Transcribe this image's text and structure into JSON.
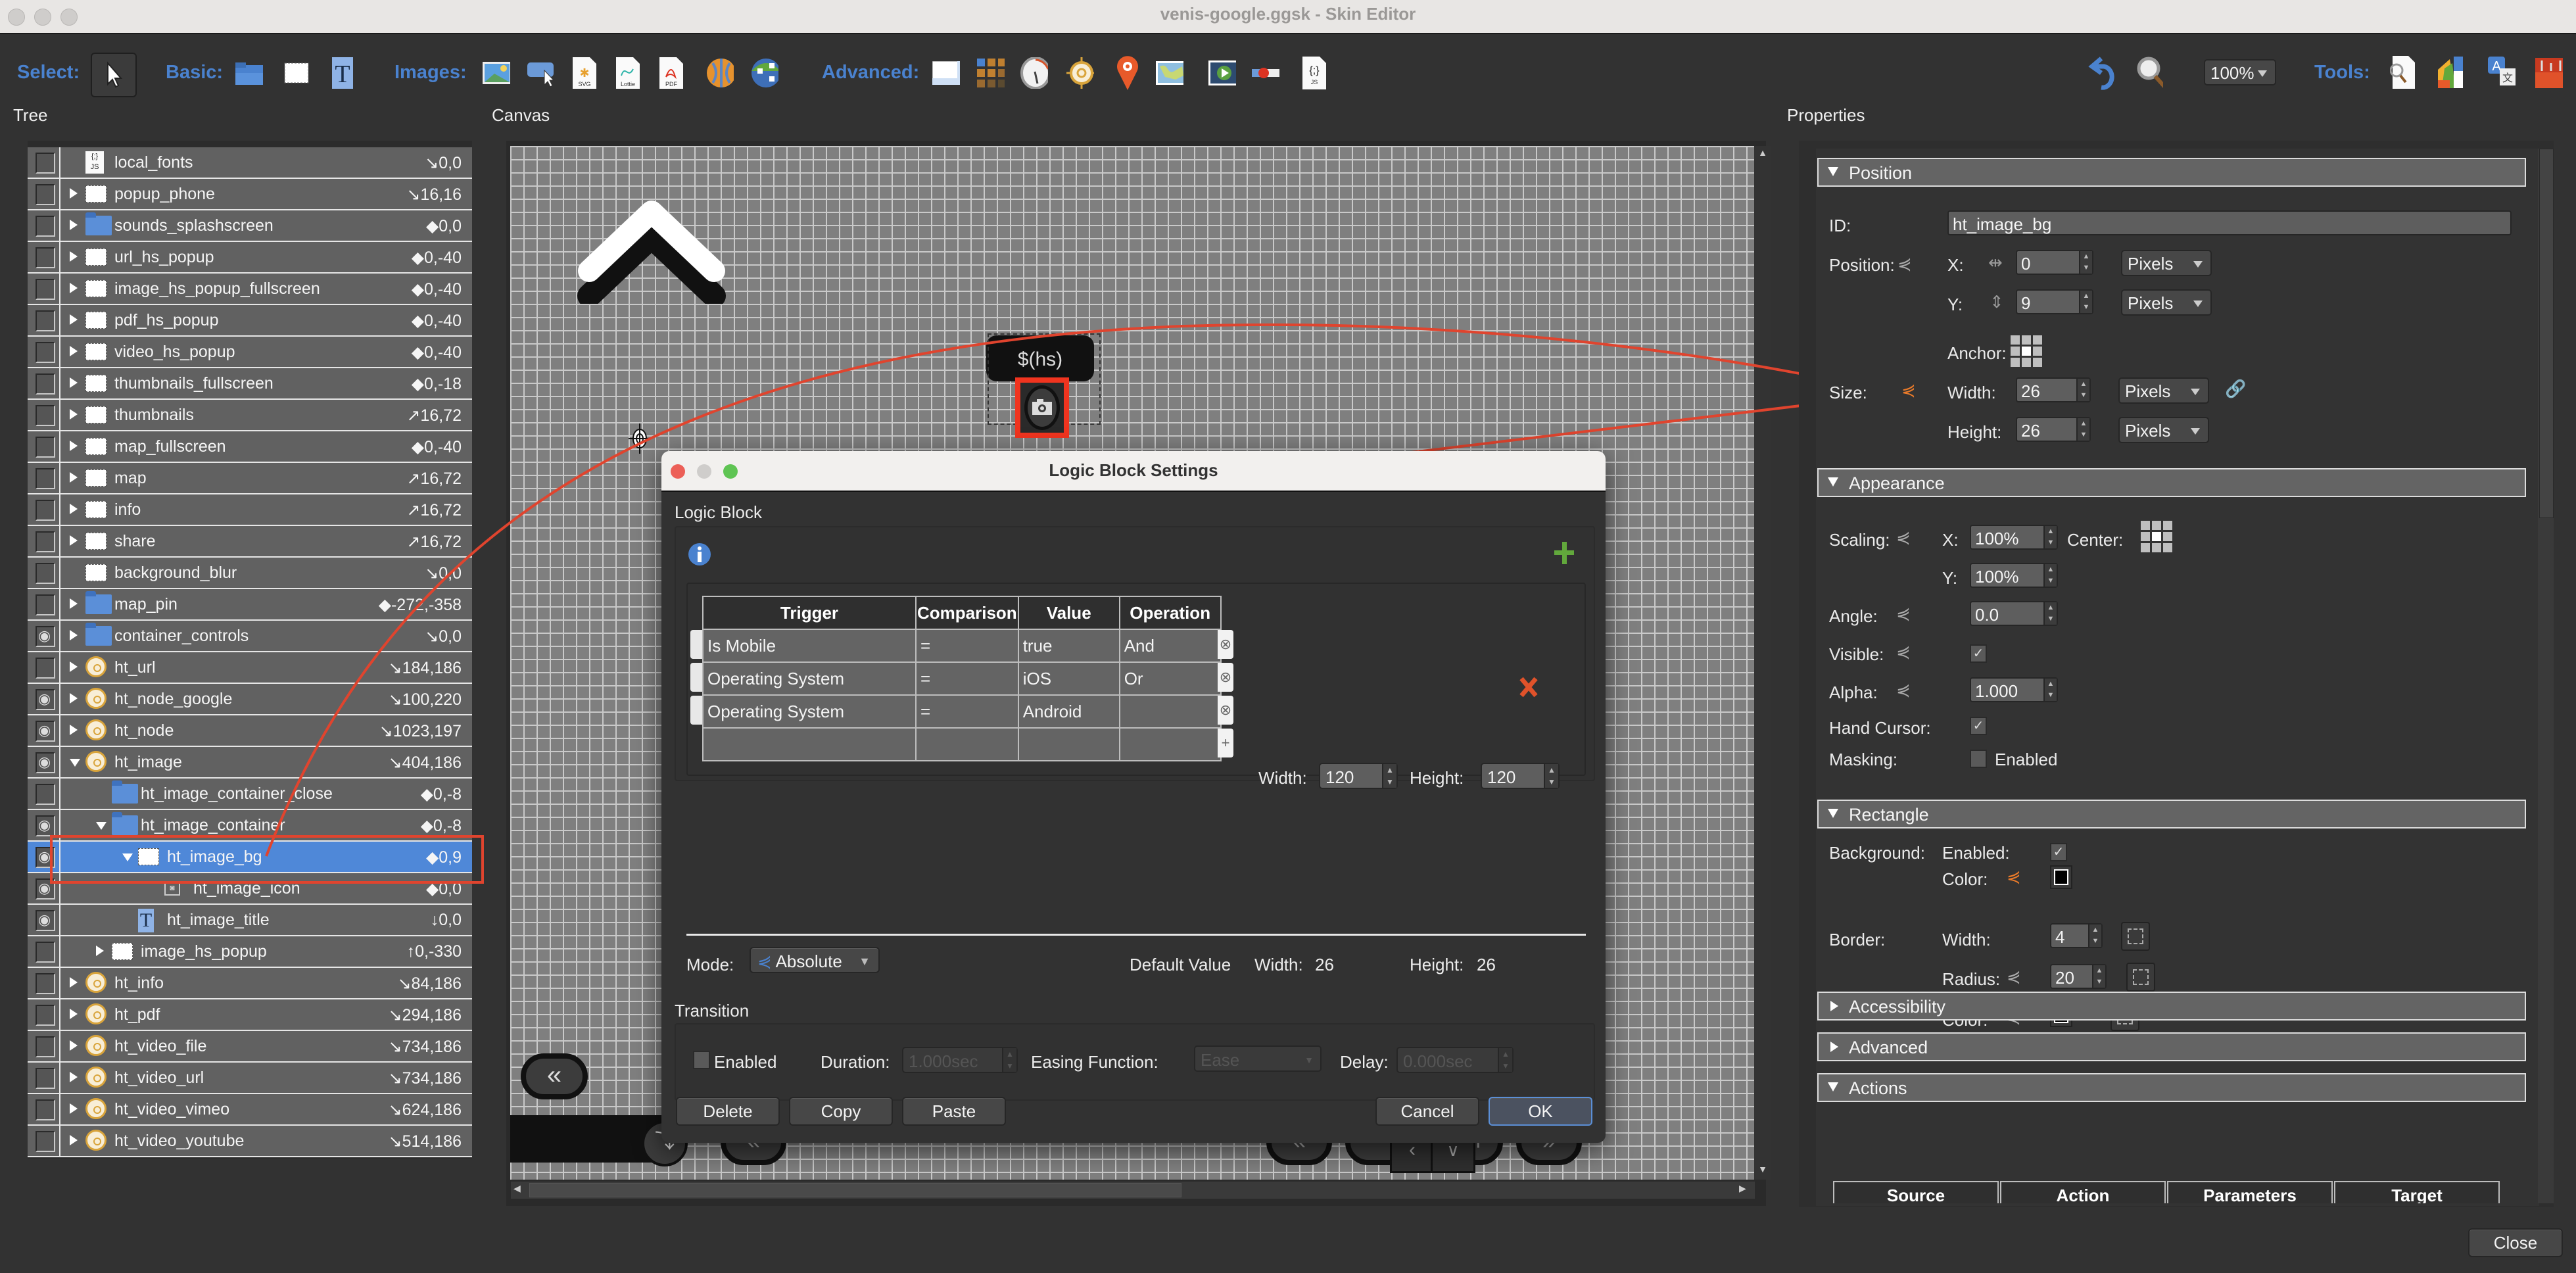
{
  "window": {
    "title": "venis-google.ggsk - Skin Editor"
  },
  "toolbar": {
    "select_label": "Select:",
    "basic_label": "Basic:",
    "images_label": "Images:",
    "advanced_label": "Advanced:",
    "tools_label": "Tools:",
    "zoom_value": "100%",
    "select_tools": [
      "pointer-icon"
    ],
    "basic_tools": [
      "container-folder-icon",
      "rectangle-icon",
      "text-icon"
    ],
    "image_tools": [
      "image-icon",
      "button-icon",
      "svg-icon",
      "lottie-icon",
      "pdf-icon",
      "panorama-icon",
      "node-icon"
    ],
    "advanced_tools": [
      "scrollarea-icon",
      "cloner-icon",
      "timer-icon",
      "hotspot-icon",
      "map-pin-icon",
      "map-icon",
      "video-icon",
      "slider-icon",
      "code-icon"
    ],
    "right_tools": [
      "undo-icon",
      "zoom-tool-icon"
    ],
    "tool_icons": [
      "file-search-icon",
      "color-palette-icon",
      "translate-icon",
      "toolbox-icon"
    ]
  },
  "panels": {
    "tree_title": "Tree",
    "canvas_title": "Canvas",
    "properties_title": "Properties"
  },
  "tree": {
    "rows": [
      {
        "name": "local_fonts",
        "coord": "↘0,0",
        "icon": "code",
        "indent": 0,
        "expander": "none",
        "visible": false,
        "selected": false
      },
      {
        "name": "popup_phone",
        "coord": "↘16,16",
        "icon": "rect",
        "indent": 0,
        "expander": "collapsed",
        "visible": false,
        "selected": false
      },
      {
        "name": "sounds_splashscreen",
        "coord": "◆0,0",
        "icon": "folder",
        "indent": 0,
        "expander": "collapsed",
        "visible": false,
        "selected": false
      },
      {
        "name": "url_hs_popup",
        "coord": "◆0,-40",
        "icon": "rect",
        "indent": 0,
        "expander": "collapsed",
        "visible": false,
        "selected": false
      },
      {
        "name": "image_hs_popup_fullscreen",
        "coord": "◆0,-40",
        "icon": "rect",
        "indent": 0,
        "expander": "collapsed",
        "visible": false,
        "selected": false
      },
      {
        "name": "pdf_hs_popup",
        "coord": "◆0,-40",
        "icon": "rect",
        "indent": 0,
        "expander": "collapsed",
        "visible": false,
        "selected": false
      },
      {
        "name": "video_hs_popup",
        "coord": "◆0,-40",
        "icon": "rect",
        "indent": 0,
        "expander": "collapsed",
        "visible": false,
        "selected": false
      },
      {
        "name": "thumbnails_fullscreen",
        "coord": "◆0,-18",
        "icon": "rect",
        "indent": 0,
        "expander": "collapsed",
        "visible": false,
        "selected": false
      },
      {
        "name": "thumbnails",
        "coord": "↗16,72",
        "icon": "rect",
        "indent": 0,
        "expander": "collapsed",
        "visible": false,
        "selected": false
      },
      {
        "name": "map_fullscreen",
        "coord": "◆0,-40",
        "icon": "rect",
        "indent": 0,
        "expander": "collapsed",
        "visible": false,
        "selected": false
      },
      {
        "name": "map",
        "coord": "↗16,72",
        "icon": "rect",
        "indent": 0,
        "expander": "collapsed",
        "visible": false,
        "selected": false
      },
      {
        "name": "info",
        "coord": "↗16,72",
        "icon": "rect",
        "indent": 0,
        "expander": "collapsed",
        "visible": false,
        "selected": false
      },
      {
        "name": "share",
        "coord": "↗16,72",
        "icon": "rect",
        "indent": 0,
        "expander": "collapsed",
        "visible": false,
        "selected": false
      },
      {
        "name": "background_blur",
        "coord": "↘0,0",
        "icon": "rect",
        "indent": 0,
        "expander": "none",
        "visible": false,
        "selected": false
      },
      {
        "name": "map_pin",
        "coord": "◆-272,-358",
        "icon": "folder",
        "indent": 0,
        "expander": "collapsed",
        "visible": false,
        "selected": false
      },
      {
        "name": "container_controls",
        "coord": "↘0,0",
        "icon": "folder",
        "indent": 0,
        "expander": "collapsed",
        "visible": true,
        "selected": false
      },
      {
        "name": "ht_url",
        "coord": "↘184,186",
        "icon": "hotspot",
        "indent": 0,
        "expander": "collapsed",
        "visible": false,
        "selected": false
      },
      {
        "name": "ht_node_google",
        "coord": "↘100,220",
        "icon": "hotspot",
        "indent": 0,
        "expander": "collapsed",
        "visible": true,
        "selected": false
      },
      {
        "name": "ht_node",
        "coord": "↘1023,197",
        "icon": "hotspot",
        "indent": 0,
        "expander": "collapsed",
        "visible": true,
        "selected": false
      },
      {
        "name": "ht_image",
        "coord": "↘404,186",
        "icon": "hotspot",
        "indent": 0,
        "expander": "expanded",
        "visible": true,
        "selected": false
      },
      {
        "name": "ht_image_container_close",
        "coord": "◆0,-8",
        "icon": "folder",
        "indent": 1,
        "expander": "none",
        "visible": false,
        "selected": false
      },
      {
        "name": "ht_image_container",
        "coord": "◆0,-8",
        "icon": "folder",
        "indent": 1,
        "expander": "expanded",
        "visible": true,
        "selected": false
      },
      {
        "name": "ht_image_bg",
        "coord": "◆0,9",
        "icon": "rect",
        "indent": 2,
        "expander": "expanded",
        "visible": true,
        "selected": true
      },
      {
        "name": "ht_image_icon",
        "coord": "◆0,0",
        "icon": "image",
        "indent": 3,
        "expander": "none",
        "visible": true,
        "selected": false
      },
      {
        "name": "ht_image_title",
        "coord": "↓0,0",
        "icon": "text",
        "indent": 2,
        "expander": "none",
        "visible": true,
        "selected": false
      },
      {
        "name": "image_hs_popup",
        "coord": "↑0,-330",
        "icon": "rect",
        "indent": 1,
        "expander": "collapsed",
        "visible": false,
        "selected": false
      },
      {
        "name": "ht_info",
        "coord": "↘84,186",
        "icon": "hotspot",
        "indent": 0,
        "expander": "collapsed",
        "visible": false,
        "selected": false
      },
      {
        "name": "ht_pdf",
        "coord": "↘294,186",
        "icon": "hotspot",
        "indent": 0,
        "expander": "collapsed",
        "visible": false,
        "selected": false
      },
      {
        "name": "ht_video_file",
        "coord": "↘734,186",
        "icon": "hotspot",
        "indent": 0,
        "expander": "collapsed",
        "visible": false,
        "selected": false
      },
      {
        "name": "ht_video_url",
        "coord": "↘734,186",
        "icon": "hotspot",
        "indent": 0,
        "expander": "collapsed",
        "visible": false,
        "selected": false
      },
      {
        "name": "ht_video_vimeo",
        "coord": "↘624,186",
        "icon": "hotspot",
        "indent": 0,
        "expander": "collapsed",
        "visible": false,
        "selected": false
      },
      {
        "name": "ht_video_youtube",
        "coord": "↘514,186",
        "icon": "hotspot",
        "indent": 0,
        "expander": "collapsed",
        "visible": false,
        "selected": false
      }
    ]
  },
  "canvas": {
    "hotspot_text": "$(hs)"
  },
  "dialog": {
    "title": "Logic Block Settings",
    "logic_block_label": "Logic Block",
    "table": {
      "headers": [
        "Trigger",
        "Comparison",
        "Value",
        "Operation"
      ],
      "rows": [
        [
          "Is Mobile",
          "=",
          "true",
          "And"
        ],
        [
          "Operating System",
          "=",
          "iOS",
          "Or"
        ],
        [
          "Operating System",
          "=",
          "Android",
          ""
        ],
        [
          "",
          "",
          "",
          ""
        ]
      ]
    },
    "width_label": "Width:",
    "width_value": "120",
    "height_label": "Height:",
    "height_value": "120",
    "mode_label": "Mode:",
    "mode_value": "Absolute",
    "default_value_label": "Default Value",
    "default_width_label": "Width:",
    "default_width_value": "26",
    "default_height_label": "Height:",
    "default_height_value": "26",
    "transition_label": "Transition",
    "transition_enabled_label": "Enabled",
    "transition_enabled": false,
    "duration_label": "Duration:",
    "duration_value": "1.000sec",
    "easing_label": "Easing Function:",
    "easing_value": "Ease",
    "delay_label": "Delay:",
    "delay_value": "0.000sec",
    "buttons": {
      "delete": "Delete",
      "copy": "Copy",
      "paste": "Paste",
      "cancel": "Cancel",
      "ok": "OK"
    }
  },
  "properties": {
    "position_section": "Position",
    "id_label": "ID:",
    "id_value": "ht_image_bg",
    "position_label": "Position:",
    "x_label": "X:",
    "x_value": "0",
    "x_unit": "Pixels",
    "y_label": "Y:",
    "y_value": "9",
    "y_unit": "Pixels",
    "anchor_label": "Anchor:",
    "size_label": "Size:",
    "width_label": "Width:",
    "width_value": "26",
    "width_unit": "Pixels",
    "height_label": "Height:",
    "height_value": "26",
    "height_unit": "Pixels",
    "appearance_section": "Appearance",
    "scaling_label": "Scaling:",
    "scale_x_label": "X:",
    "scale_x_value": "100%",
    "center_label": "Center:",
    "scale_y_label": "Y:",
    "scale_y_value": "100%",
    "angle_label": "Angle:",
    "angle_value": "0.0",
    "visible_label": "Visible:",
    "visible_checked": true,
    "alpha_label": "Alpha:",
    "alpha_value": "1.000",
    "hand_cursor_label": "Hand Cursor:",
    "hand_cursor_checked": true,
    "masking_label": "Masking:",
    "masking_enabled_label": "Enabled",
    "masking_checked": false,
    "rectangle_section": "Rectangle",
    "background_label": "Background:",
    "bg_enabled_label": "Enabled:",
    "bg_enabled_checked": true,
    "bg_color_label": "Color:",
    "bg_color": "#ffffff",
    "border_label": "Border:",
    "border_width_label": "Width:",
    "border_width_value": "4",
    "border_radius_label": "Radius:",
    "border_radius_value": "20",
    "border_color_label": "Color:",
    "border_color": "#000000",
    "accessibility_section": "Accessibility",
    "advanced_section": "Advanced",
    "actions_section": "Actions",
    "actions_headers": [
      "Source",
      "Action",
      "Parameters",
      "Target"
    ]
  },
  "footer": {
    "close_label": "Close"
  },
  "colors": {
    "accent": "#4a82cf",
    "selection": "#4f88d8",
    "annotation_red": "#e0442e"
  }
}
